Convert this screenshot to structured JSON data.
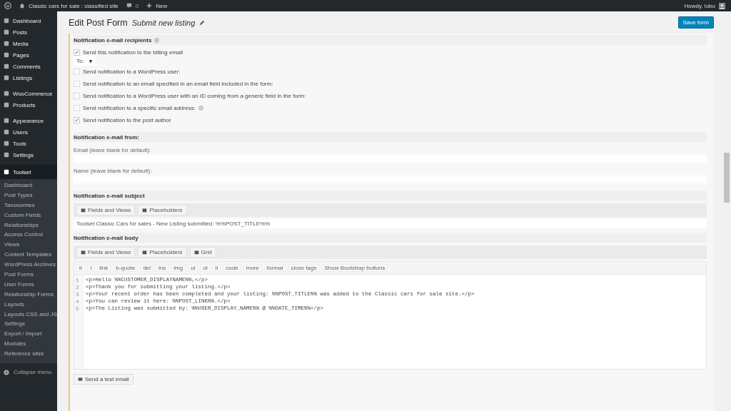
{
  "admin_bar": {
    "site_title": "Classic cars for sale : classified site",
    "comments_count": "0",
    "new_label": "New",
    "greeting": "Howdy, lobo"
  },
  "sidebar": {
    "items": [
      {
        "label": "Dashboard",
        "selected": false
      },
      {
        "label": "Posts",
        "selected": false
      },
      {
        "label": "Media",
        "selected": false
      },
      {
        "label": "Pages",
        "selected": false
      },
      {
        "label": "Comments",
        "selected": false
      },
      {
        "label": "Listings",
        "selected": false
      },
      {
        "label": "WooCommerce",
        "selected": false
      },
      {
        "label": "Products",
        "selected": false
      },
      {
        "label": "Appearance",
        "selected": false
      },
      {
        "label": "Users",
        "selected": false
      },
      {
        "label": "Tools",
        "selected": false
      },
      {
        "label": "Settings",
        "selected": false
      },
      {
        "label": "Toolset",
        "selected": true
      }
    ],
    "submenu": [
      "Dashboard",
      "Post Types",
      "Taxonomies",
      "Custom Fields",
      "Relationships",
      "Access Control",
      "Views",
      "Content Templates",
      "WordPress Archives",
      "Post Forms",
      "User Forms",
      "Relationship Forms",
      "Layouts",
      "Layouts CSS and JS",
      "Settings",
      "Export / Import",
      "Modules",
      "Reference sites"
    ],
    "collapse_label": "Collapse menu"
  },
  "page": {
    "title": "Edit Post Form",
    "subtitle": "Submit new listing",
    "save_button": "Save form"
  },
  "recipients": {
    "heading": "Notification e-mail recipients",
    "options": [
      {
        "label": "Send this notification to the billing email",
        "checked": true,
        "help": false,
        "select": "To:"
      },
      {
        "label": "Send notification to a WordPress user:",
        "checked": false,
        "help": false
      },
      {
        "label": "Send notification to an email specified in an email field included in the form:",
        "checked": false,
        "help": false
      },
      {
        "label": "Send notification to a WordPress user with an ID coming from a generic field in the form:",
        "checked": false,
        "help": false
      },
      {
        "label": "Send notification to a specific email address:",
        "checked": false,
        "help": true
      },
      {
        "label": "Send notification to the post author",
        "checked": true,
        "help": false
      }
    ]
  },
  "from": {
    "heading": "Notification e-mail from:",
    "fields": [
      {
        "label": "Email (leave blank for default):"
      },
      {
        "label": "Name (leave blank for default):"
      }
    ]
  },
  "subject": {
    "heading": "Notification e-mail subject",
    "toolbar": [
      "Fields and Views",
      "Placeholders"
    ],
    "value": "Toolset Classic Cars for sales  - New Listing submitted: %%POST_TITLE%%"
  },
  "body": {
    "heading": "Notification e-mail body",
    "toolbar": [
      "Fields and Views",
      "Placeholders",
      "Grid"
    ],
    "format_buttons": [
      "b",
      "i",
      "link",
      "b-quote",
      "del",
      "ins",
      "img",
      "ul",
      "ol",
      "li",
      "code",
      "more",
      "format",
      "close tags",
      "Show Bootstrap buttons"
    ],
    "lines": [
      {
        "number": "1",
        "code": "<p>Hello %%CUSTOMER_DISPLAYNAME%%,</p>"
      },
      {
        "number": "2",
        "code": "<p>Thank you for submitting your listing.</p>"
      },
      {
        "number": "3",
        "code": "<p>Your recent order has been completed and your listing: %%POST_TITLE%% was added to the Classic cars for sale site.</p>"
      },
      {
        "number": "4",
        "code": "<p>You can review it here: %%POST_LINK%%.</p>"
      },
      {
        "number": "5",
        "code": "<p>The Listing was submitted by: %%USER_DISPLAY_NAME%% @ %%DATE_TIME%%</p>"
      }
    ],
    "test_button": "Send a test email"
  }
}
